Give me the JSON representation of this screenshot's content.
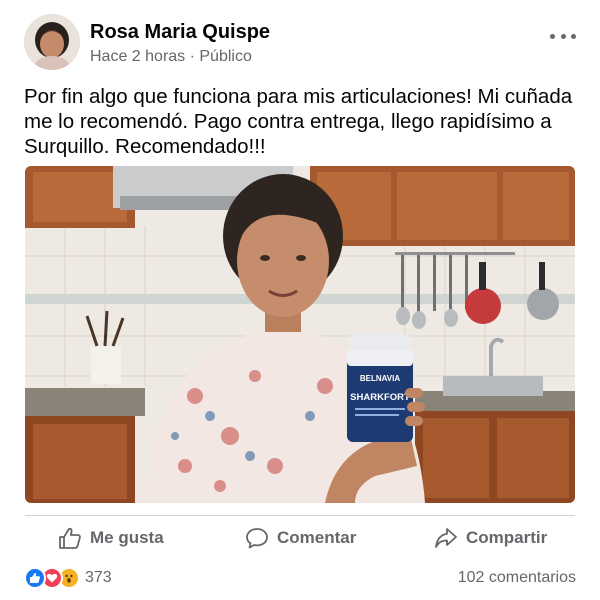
{
  "post": {
    "author_name": "Rosa Maria Quispe",
    "meta": "Hace 2 horas · Público",
    "text": "Por fin algo que funciona para mis articulaciones! Mi cuñada me lo recomendó. Pago contra entrega, llego rapidísimo a Surquillo. Recomendado!!!",
    "photo": {
      "bottle_brand": "BELNAVIA",
      "bottle_product": "SHARKFORT",
      "bottle_color": "#1e3a73"
    }
  },
  "actions": {
    "like_label": "Me gusta",
    "comment_label": "Comentar",
    "share_label": "Compartir"
  },
  "footer": {
    "reaction_icons": [
      "like-reaction-icon",
      "love-reaction-icon",
      "wow-reaction-icon"
    ],
    "reaction_count": "373",
    "comments_count": "102 comentarios"
  },
  "colors": {
    "secondary_text": "#65676b",
    "primary_text": "#050505",
    "like_blue": "#1877f2",
    "love_red": "#f33e58",
    "wow_yellow": "#f7b125"
  }
}
